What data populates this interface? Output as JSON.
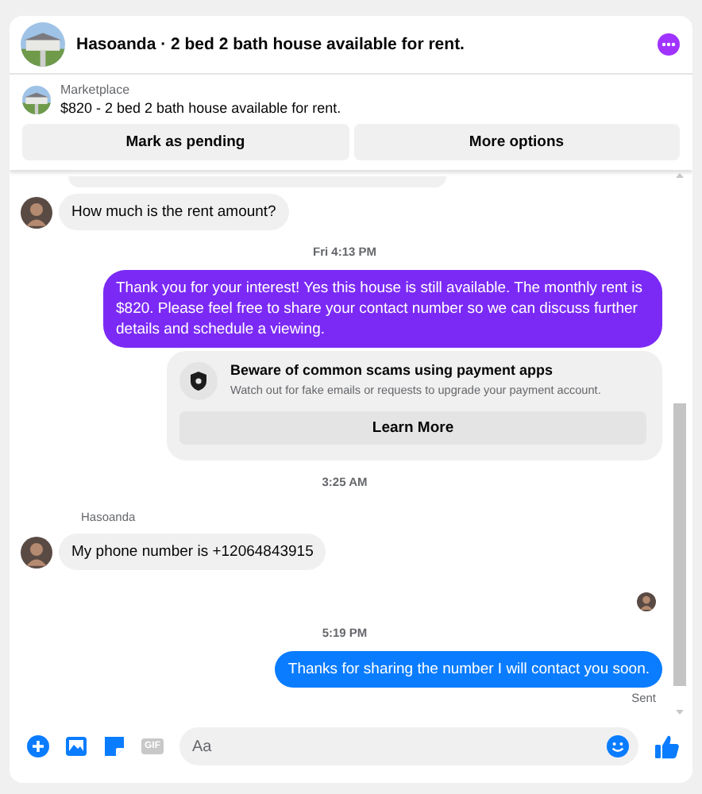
{
  "header": {
    "title": "Hasoanda · 2 bed 2 bath house available for rent."
  },
  "listing": {
    "source": "Marketplace",
    "title": "$820 - 2 bed 2 bath house available for rent.",
    "buttons": [
      "Mark as pending",
      "More options"
    ]
  },
  "messages": [
    {
      "kind": "partial"
    },
    {
      "kind": "incoming",
      "text": "How much is the rent amount?"
    },
    {
      "kind": "timestamp",
      "text": "Fri 4:13 PM"
    },
    {
      "kind": "outgoing",
      "color": "#7b2af5",
      "text": "Thank you for your interest! Yes this house is still available. The monthly rent is $820. Please feel free to share your contact number so we can discuss further details and schedule a viewing."
    },
    {
      "kind": "notice",
      "title": "Beware of common scams using payment apps",
      "body": "Watch out for fake emails or requests to upgrade your payment account.",
      "button": "Learn More"
    },
    {
      "kind": "timestamp",
      "text": "3:25 AM"
    },
    {
      "kind": "incoming",
      "sender": "Hasoanda",
      "text": "My phone number is +12064843915"
    },
    {
      "kind": "seen"
    },
    {
      "kind": "timestamp",
      "text": "5:19 PM"
    },
    {
      "kind": "outgoing",
      "color": "#0a7cff",
      "text": "Thanks for sharing the number I will contact you soon."
    },
    {
      "kind": "status",
      "text": "Sent"
    }
  ],
  "composer": {
    "gif_label": "GIF",
    "placeholder": "Aa"
  }
}
